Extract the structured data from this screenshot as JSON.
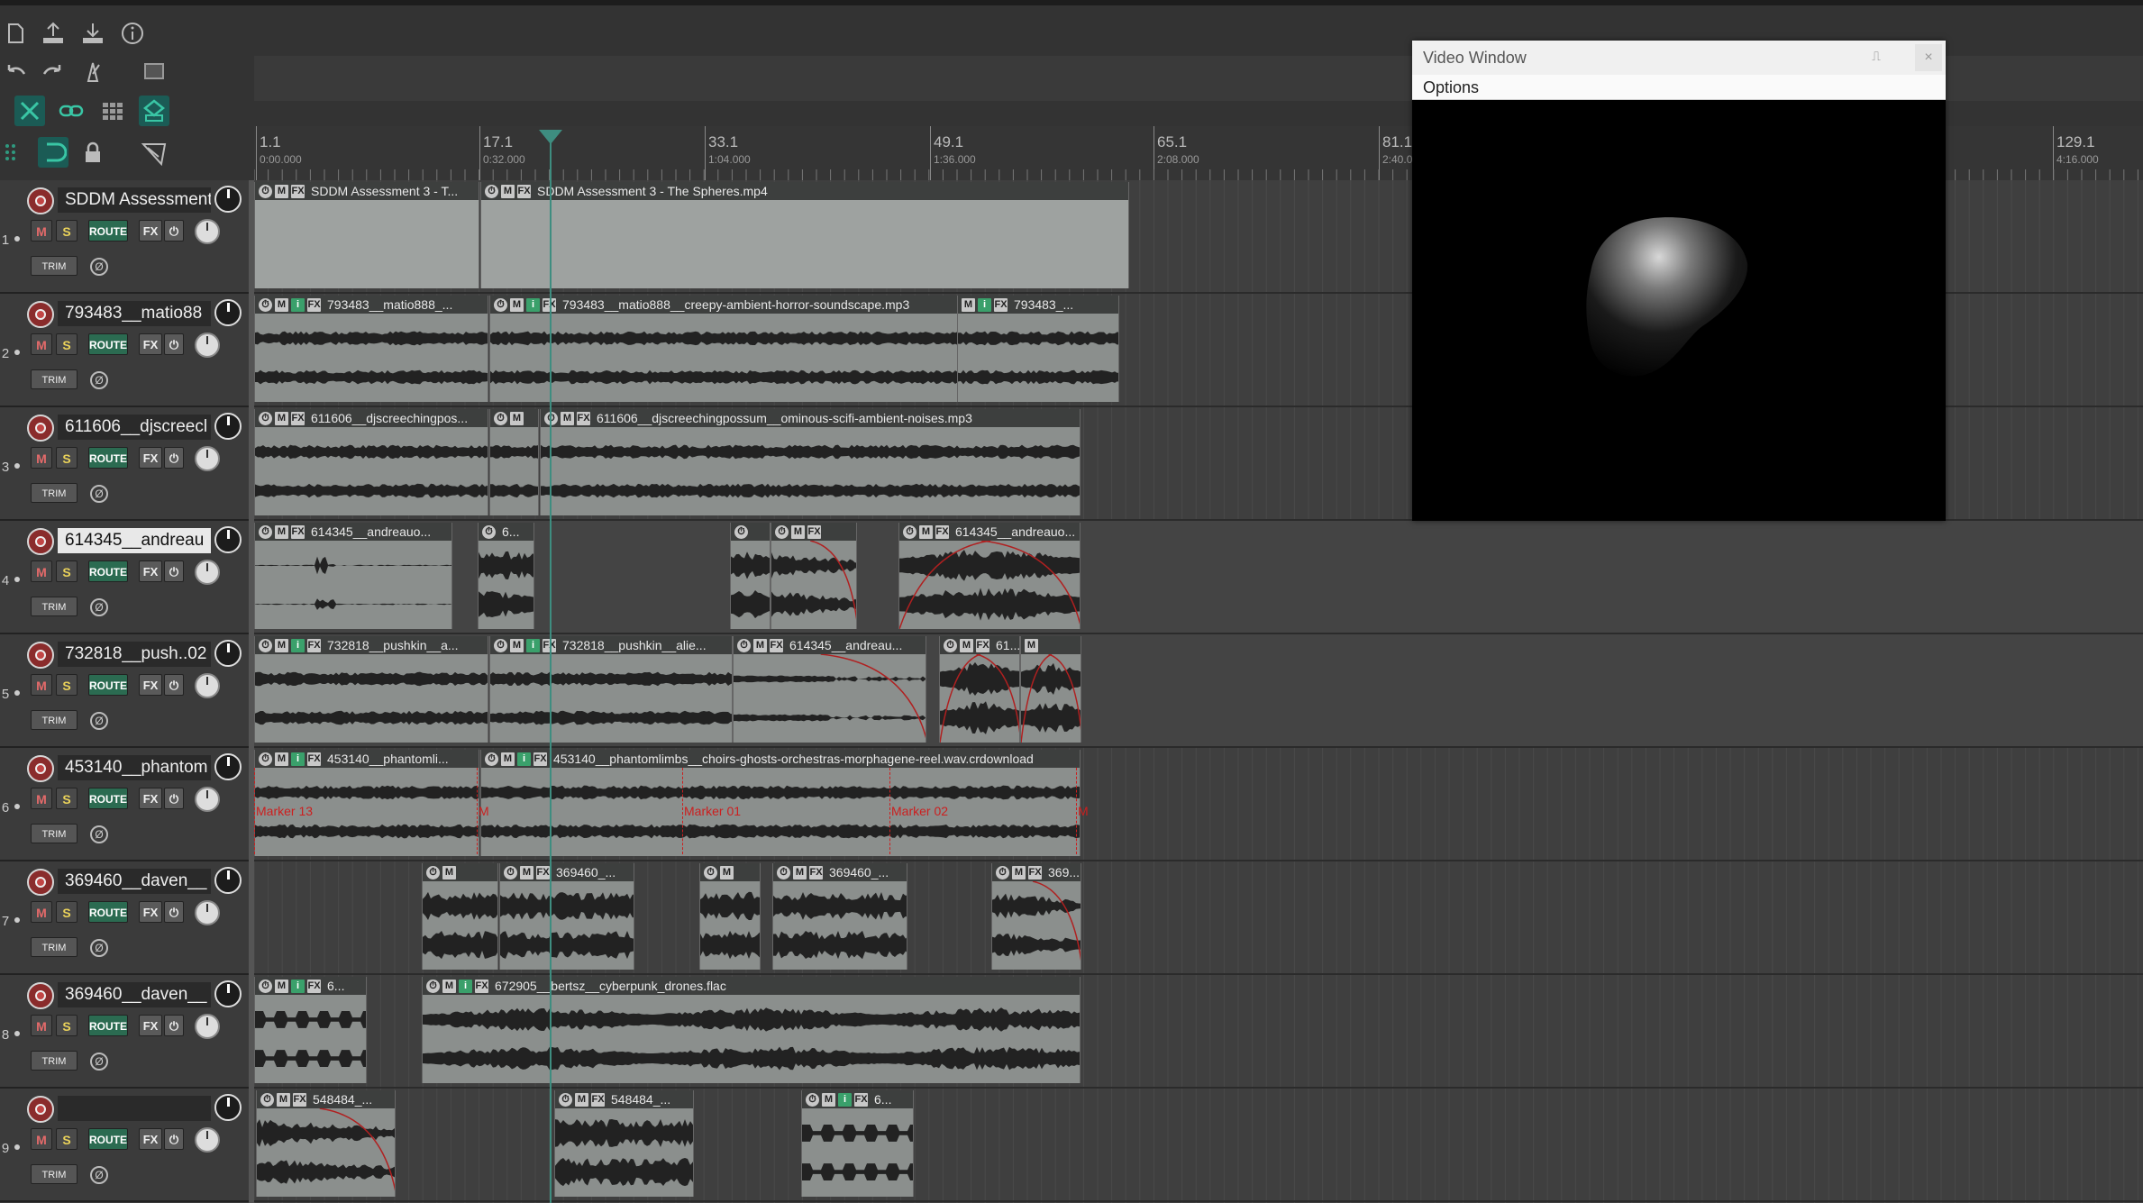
{
  "toolbar": {
    "icons": [
      "new-project-icon",
      "save-upload-icon",
      "save-download-icon",
      "info-icon",
      "undo-icon",
      "redo-icon",
      "metronome-icon",
      "marquee-icon",
      "ripple-edit-icon",
      "link-icon",
      "grid-icon",
      "item-grouping-icon",
      "snap-grid-icon",
      "loop-icon",
      "lock-icon",
      "envelope-cursor-icon"
    ]
  },
  "ruler": {
    "marks": [
      {
        "bar": "1.1",
        "time": "0:00.000"
      },
      {
        "bar": "17.1",
        "time": "0:32.000"
      },
      {
        "bar": "33.1",
        "time": "1:04.000"
      },
      {
        "bar": "49.1",
        "time": "1:36.000"
      },
      {
        "bar": "65.1",
        "time": "2:08.000"
      },
      {
        "bar": "81.1",
        "time": "2:40.0"
      },
      {
        "bar": "129.1",
        "time": "4:16.000"
      }
    ]
  },
  "tracks": [
    {
      "num": "1",
      "name": "SDDM Assessment",
      "selected": false
    },
    {
      "num": "2",
      "name": "793483__matio88",
      "selected": false
    },
    {
      "num": "3",
      "name": "611606__djscreecl",
      "selected": false
    },
    {
      "num": "4",
      "name": "614345__andreau",
      "selected": true
    },
    {
      "num": "5",
      "name": "732818__push..02",
      "selected": false
    },
    {
      "num": "6",
      "name": "453140__phantom",
      "selected": false
    },
    {
      "num": "7",
      "name": "369460__daven__",
      "selected": false
    },
    {
      "num": "8",
      "name": "369460__daven__",
      "selected": false
    },
    {
      "num": "9",
      "name": "",
      "selected": false
    }
  ],
  "track_controls": {
    "mute": "M",
    "solo": "S",
    "route": "ROUTE",
    "fx": "FX",
    "power": "⏻",
    "trim": "TRIM",
    "phase": "Ø"
  },
  "items": {
    "t1": [
      "SDDM Assessment 3 - T...",
      "SDDM Assessment 3 - The Spheres.mp4"
    ],
    "t2": [
      "793483__matio888_...",
      "793483__matio888__creepy-ambient-horror-soundscape.mp3",
      "793483_..."
    ],
    "t3": [
      "611606__djscreechingpos...",
      "",
      "611606__djscreechingpossum__ominous-scifi-ambient-noises.mp3"
    ],
    "t4": [
      "614345__andreauo...",
      "6...",
      "",
      "",
      "614345__andreauo..."
    ],
    "t5": [
      "732818__pushkin__a...",
      "732818__pushkin__alie...",
      "614345__andreau...",
      "61...",
      ""
    ],
    "t6": [
      "453140__phantomli...",
      "453140__phantomlimbs__choirs-ghosts-orchestras-morphagene-reel.wav.crdownload"
    ],
    "t7": [
      "",
      "369460_...",
      "",
      "369460_...",
      "369..."
    ],
    "t8": [
      "6...",
      "672905__bertsz__cyberpunk_drones.flac"
    ],
    "t9": [
      "548484_...",
      "548484_...",
      "6..."
    ]
  },
  "markers": [
    "Marker 13",
    "M",
    "Marker 01",
    "Marker 02",
    "M"
  ],
  "video_window": {
    "title": "Video Window",
    "minimize": "⎍",
    "close": "×",
    "menu": "Options"
  },
  "colors": {
    "playhead": "#3e8d80",
    "route": "#2b6b51",
    "marker": "#cc1f1f",
    "item": "#8b8f8d"
  }
}
